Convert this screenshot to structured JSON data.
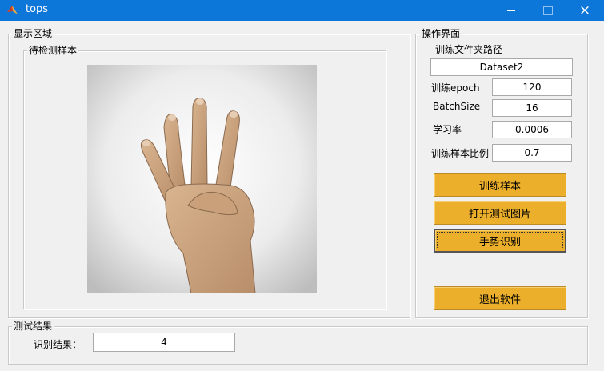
{
  "window": {
    "title": "tops",
    "controls": {
      "minimize": "minimize-icon",
      "maximize": "maximize-icon",
      "close": "×"
    }
  },
  "display_panel": {
    "title": "显示区域",
    "sample_group": {
      "title": "待检测样本",
      "image": "hand-showing-four-fingers"
    }
  },
  "ops_panel": {
    "title": "操作界面",
    "folder_label": "训练文件夹路径",
    "folder_value": "Dataset2",
    "epoch_label": "训练epoch",
    "epoch_value": "120",
    "batch_label": "BatchSize",
    "batch_value": "16",
    "lr_label": "学习率",
    "lr_value": "0.0006",
    "ratio_label": "训练样本比例",
    "ratio_value": "0.7",
    "buttons": {
      "train": "训练样本",
      "open_image": "打开测试图片",
      "recognize": "手势识别",
      "exit": "退出软件"
    }
  },
  "result_panel": {
    "title": "测试结果",
    "result_label": "识别结果：",
    "result_value": "4"
  },
  "colors": {
    "titlebar": "#0c77d8",
    "button": "#ecaf2b",
    "background": "#f0f0f0"
  }
}
